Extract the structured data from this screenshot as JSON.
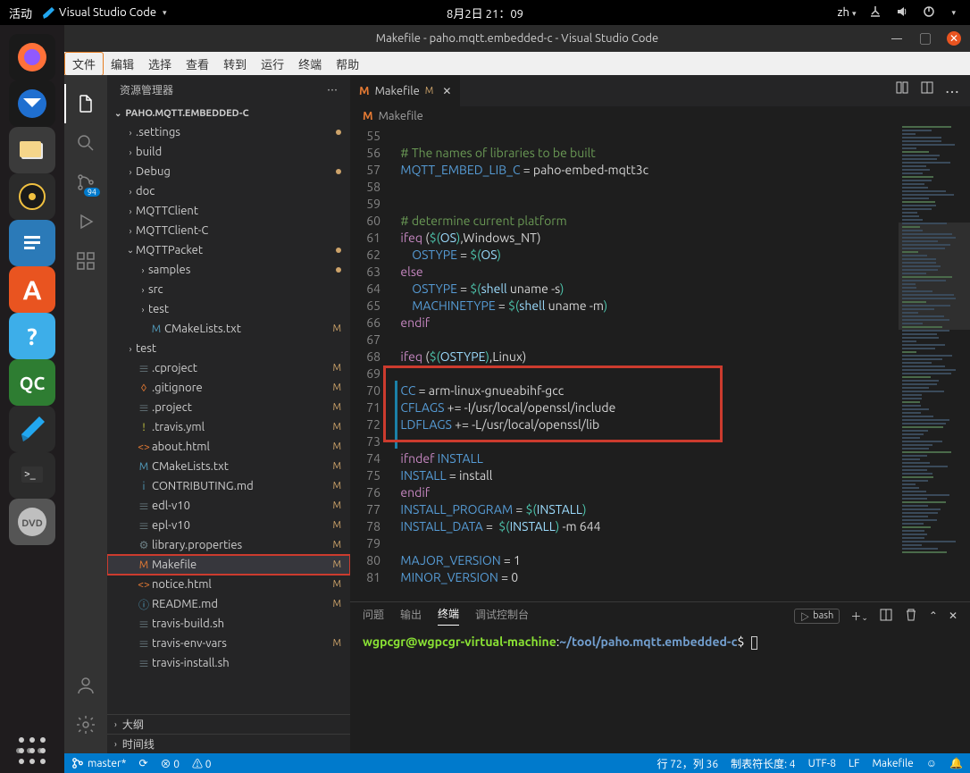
{
  "gnome": {
    "activities": "活动",
    "app": "Visual Studio Code",
    "clock": "8月2日 21：09",
    "lang": "zh"
  },
  "window": {
    "title": "Makefile - paho.mqtt.embedded-c - Visual Studio Code"
  },
  "menubar": [
    "文件",
    "编辑",
    "选择",
    "查看",
    "转到",
    "运行",
    "终端",
    "帮助"
  ],
  "sidebar": {
    "title": "资源管理器",
    "project": "PAHO.MQTT.EMBEDDED-C",
    "outline": "大纲",
    "timeline": "时间线"
  },
  "tree": [
    {
      "d": 1,
      "t": "folder-o",
      "n": ".settings",
      "dot": true
    },
    {
      "d": 1,
      "t": "folder-o",
      "n": "build"
    },
    {
      "d": 1,
      "t": "folder-o",
      "n": "Debug",
      "dot": true
    },
    {
      "d": 1,
      "t": "folder-o",
      "n": "doc"
    },
    {
      "d": 1,
      "t": "folder-o",
      "n": "MQTTClient"
    },
    {
      "d": 1,
      "t": "folder-o",
      "n": "MQTTClient-C"
    },
    {
      "d": 1,
      "t": "folder",
      "n": "MQTTPacket",
      "dot": true
    },
    {
      "d": 2,
      "t": "folder-o",
      "n": "samples",
      "dot": true
    },
    {
      "d": 2,
      "t": "folder-o",
      "n": "src"
    },
    {
      "d": 2,
      "t": "folder-o",
      "n": "test"
    },
    {
      "d": 2,
      "t": "file",
      "n": "CMakeLists.txt",
      "ic": "M",
      "col": "#519aba",
      "m": true
    },
    {
      "d": 1,
      "t": "folder-o",
      "n": "test"
    },
    {
      "d": 1,
      "t": "file",
      "n": ".cproject",
      "ic": "≡",
      "col": "#6d8086",
      "m": true
    },
    {
      "d": 1,
      "t": "file",
      "n": ".gitignore",
      "ic": "◊",
      "col": "#e37933",
      "m": true
    },
    {
      "d": 1,
      "t": "file",
      "n": ".project",
      "ic": "≡",
      "col": "#6d8086",
      "m": true
    },
    {
      "d": 1,
      "t": "file",
      "n": ".travis.yml",
      "ic": "!",
      "col": "#cbcb41",
      "m": true
    },
    {
      "d": 1,
      "t": "file",
      "n": "about.html",
      "ic": "<>",
      "col": "#e37933",
      "m": true
    },
    {
      "d": 1,
      "t": "file",
      "n": "CMakeLists.txt",
      "ic": "M",
      "col": "#519aba",
      "m": true
    },
    {
      "d": 1,
      "t": "file",
      "n": "CONTRIBUTING.md",
      "ic": "i",
      "col": "#519aba",
      "m": true
    },
    {
      "d": 1,
      "t": "file",
      "n": "edl-v10",
      "ic": "≡",
      "col": "#6d8086",
      "m": true
    },
    {
      "d": 1,
      "t": "file",
      "n": "epl-v10",
      "ic": "≡",
      "col": "#6d8086",
      "m": true
    },
    {
      "d": 1,
      "t": "file",
      "n": "library.properties",
      "ic": "⚙",
      "col": "#6d8086",
      "m": true
    },
    {
      "d": 1,
      "t": "file",
      "n": "Makefile",
      "ic": "M",
      "col": "#e37933",
      "m": true,
      "sel": true,
      "hl": true
    },
    {
      "d": 1,
      "t": "file",
      "n": "notice.html",
      "ic": "<>",
      "col": "#e37933",
      "m": true
    },
    {
      "d": 1,
      "t": "file",
      "n": "README.md",
      "ic": "ⓘ",
      "col": "#519aba",
      "m": true
    },
    {
      "d": 1,
      "t": "file",
      "n": "travis-build.sh",
      "ic": "≡",
      "col": "#6d8086"
    },
    {
      "d": 1,
      "t": "file",
      "n": "travis-env-vars",
      "ic": "≡",
      "col": "#6d8086",
      "m": true
    },
    {
      "d": 1,
      "t": "file",
      "n": "travis-install.sh",
      "ic": "≡",
      "col": "#6d8086"
    }
  ],
  "tab": {
    "name": "Makefile"
  },
  "breadcrumb": {
    "name": "Makefile"
  },
  "code_start": 55,
  "code": [
    "",
    "  <span class='c-comment'># The names of libraries to be built</span>",
    "  <span class='c-var'>MQTT_EMBED_LIB_C</span> = paho-embed-mqtt3c",
    "",
    "",
    "  <span class='c-comment'># determine current platform</span>",
    "  <span class='c-kw'>ifeq</span> (<span class='c-func'>$(</span><span class='c-name'>OS</span><span class='c-func'>)</span>,Windows_NT)",
    "      <span class='c-var'>OSTYPE</span> = <span class='c-func'>$(</span><span class='c-name'>OS</span><span class='c-func'>)</span>",
    "  <span class='c-kw'>else</span>",
    "      <span class='c-var'>OSTYPE</span> = <span class='c-func'>$(</span><span class='c-name'>shell</span> uname -s<span class='c-func'>)</span>",
    "      <span class='c-var'>MACHINETYPE</span> = <span class='c-func'>$(</span><span class='c-name'>shell</span> uname -m<span class='c-func'>)</span>",
    "  <span class='c-kw'>endif</span>",
    "",
    "  <span class='c-kw'>ifeq</span> (<span class='c-func'>$(</span><span class='c-name'>OSTYPE</span><span class='c-func'>)</span>,Linux)",
    "",
    "  <span class='c-var'>CC</span> = arm-linux-gnueabihf-gcc",
    "  <span class='c-var'>CFLAGS</span> += -I/usr/local/openssl/include",
    "  <span class='c-var'>LDFLAGS</span> += -L/usr/local/openssl/lib",
    "",
    "  <span class='c-kw'>ifndef</span> <span class='c-var'>INSTALL</span>",
    "  <span class='c-var'>INSTALL</span> = install",
    "  <span class='c-kw'>endif</span>",
    "  <span class='c-var'>INSTALL_PROGRAM</span> = <span class='c-func'>$(</span><span class='c-name'>INSTALL</span><span class='c-func'>)</span>",
    "  <span class='c-var'>INSTALL_DATA</span> =  <span class='c-func'>$(</span><span class='c-name'>INSTALL</span><span class='c-func'>)</span> -m 644",
    "",
    "  <span class='c-var'>MAJOR_VERSION</span> = 1",
    "  <span class='c-var'>MINOR_VERSION</span> = 0"
  ],
  "panel": {
    "tabs": [
      "问题",
      "输出",
      "终端",
      "调试控制台"
    ],
    "bash": "bash",
    "prompt_user": "wgpcgr@wgpcgr-virtual-machine",
    "prompt_path": "~/tool/paho.mqtt.embedded-c"
  },
  "status": {
    "branch": "master*",
    "sync": "⟳",
    "errors": "⊗ 0",
    "warnings": "⚠ 0",
    "pos": "行 72，列 36",
    "tab": "制表符长度: 4",
    "enc": "UTF-8",
    "eol": "LF",
    "lang": "Makefile",
    "feedback": "☺",
    "bell": "🔔"
  },
  "activity_badge": "94",
  "dock_items": [
    {
      "bg": "#1a1a1a",
      "html": "<svg width='40' height='40' viewBox='0 0 40 40'><circle cx='20' cy='20' r='16' fill='#ff7139'/><circle cx='20' cy='20' r='9' fill='#9059ff'/></svg>"
    },
    {
      "bg": "#1a1a1a",
      "html": "<svg width='40' height='40' viewBox='0 0 40 40'><circle cx='20' cy='20' r='16' fill='#1f6fd0'/><path d='M10 14 L20 24 L30 14 Z' fill='#fff'/></svg>"
    },
    {
      "bg": "#3b3b3b",
      "html": "<svg width='40' height='40' viewBox='0 0 40 40'><rect x='8' y='12' width='24' height='18' rx='2' fill='#e8e8e8'/><rect x='6' y='10' width='24' height='18' rx='2' fill='#f5d58a'/></svg>"
    },
    {
      "bg": "#2b2b2b",
      "html": "<svg width='40' height='40' viewBox='0 0 40 40'><circle cx='20' cy='20' r='14' fill='#1a1a1a' stroke='#f0c040' stroke-width='2'/><circle cx='20' cy='20' r='4' fill='#f0c040'/></svg>"
    },
    {
      "bg": "#2b7ab8",
      "html": "<svg width='36' height='36' viewBox='0 0 36 36'><rect x='4' y='4' width='28' height='28' rx='4' fill='#2b7ab8'/><rect x='9' y='10' width='18' height='3' fill='#fff'/><rect x='9' y='16' width='18' height='3' fill='#fff'/><rect x='9' y='22' width='12' height='3' fill='#fff'/></svg>"
    },
    {
      "bg": "#e95420",
      "html": "<div style='color:#fff;font-weight:bold;font-size:30px'>A</div>"
    },
    {
      "bg": "#3daee9",
      "html": "<div style='color:#fff;font-weight:bold;font-size:26px'>?</div>"
    },
    {
      "bg": "#2e7d32",
      "html": "<div style='color:#fff;font-weight:bold;font-size:20px'>QC</div>"
    },
    {
      "bg": "#2b2b2b",
      "html": "<svg width='36' height='36' viewBox='0 0 36 36'><path d='M26 4 L32 10 L14 28 L8 32 L6 24 Z' fill='#22a7f0'/><path d='M6 24 L14 28 L8 32 Z' fill='#1b7db5'/></svg>"
    },
    {
      "bg": "#2b2b2b",
      "html": "<svg width='36' height='36' viewBox='0 0 36 36'><rect x='6' y='8' width='24' height='18' rx='2' fill='#333'/><text x='9' y='20' fill='#eee' font-size='12' font-family='monospace'>&gt;_</text></svg>"
    },
    {
      "bg": "#555",
      "html": "<svg width='40' height='40' viewBox='0 0 40 40'><circle cx='20' cy='20' r='16' fill='#bfbfbf'/><text x='20' y='25' text-anchor='middle' fill='#555' font-size='11' font-weight='bold'>DVD</text></svg>"
    }
  ]
}
